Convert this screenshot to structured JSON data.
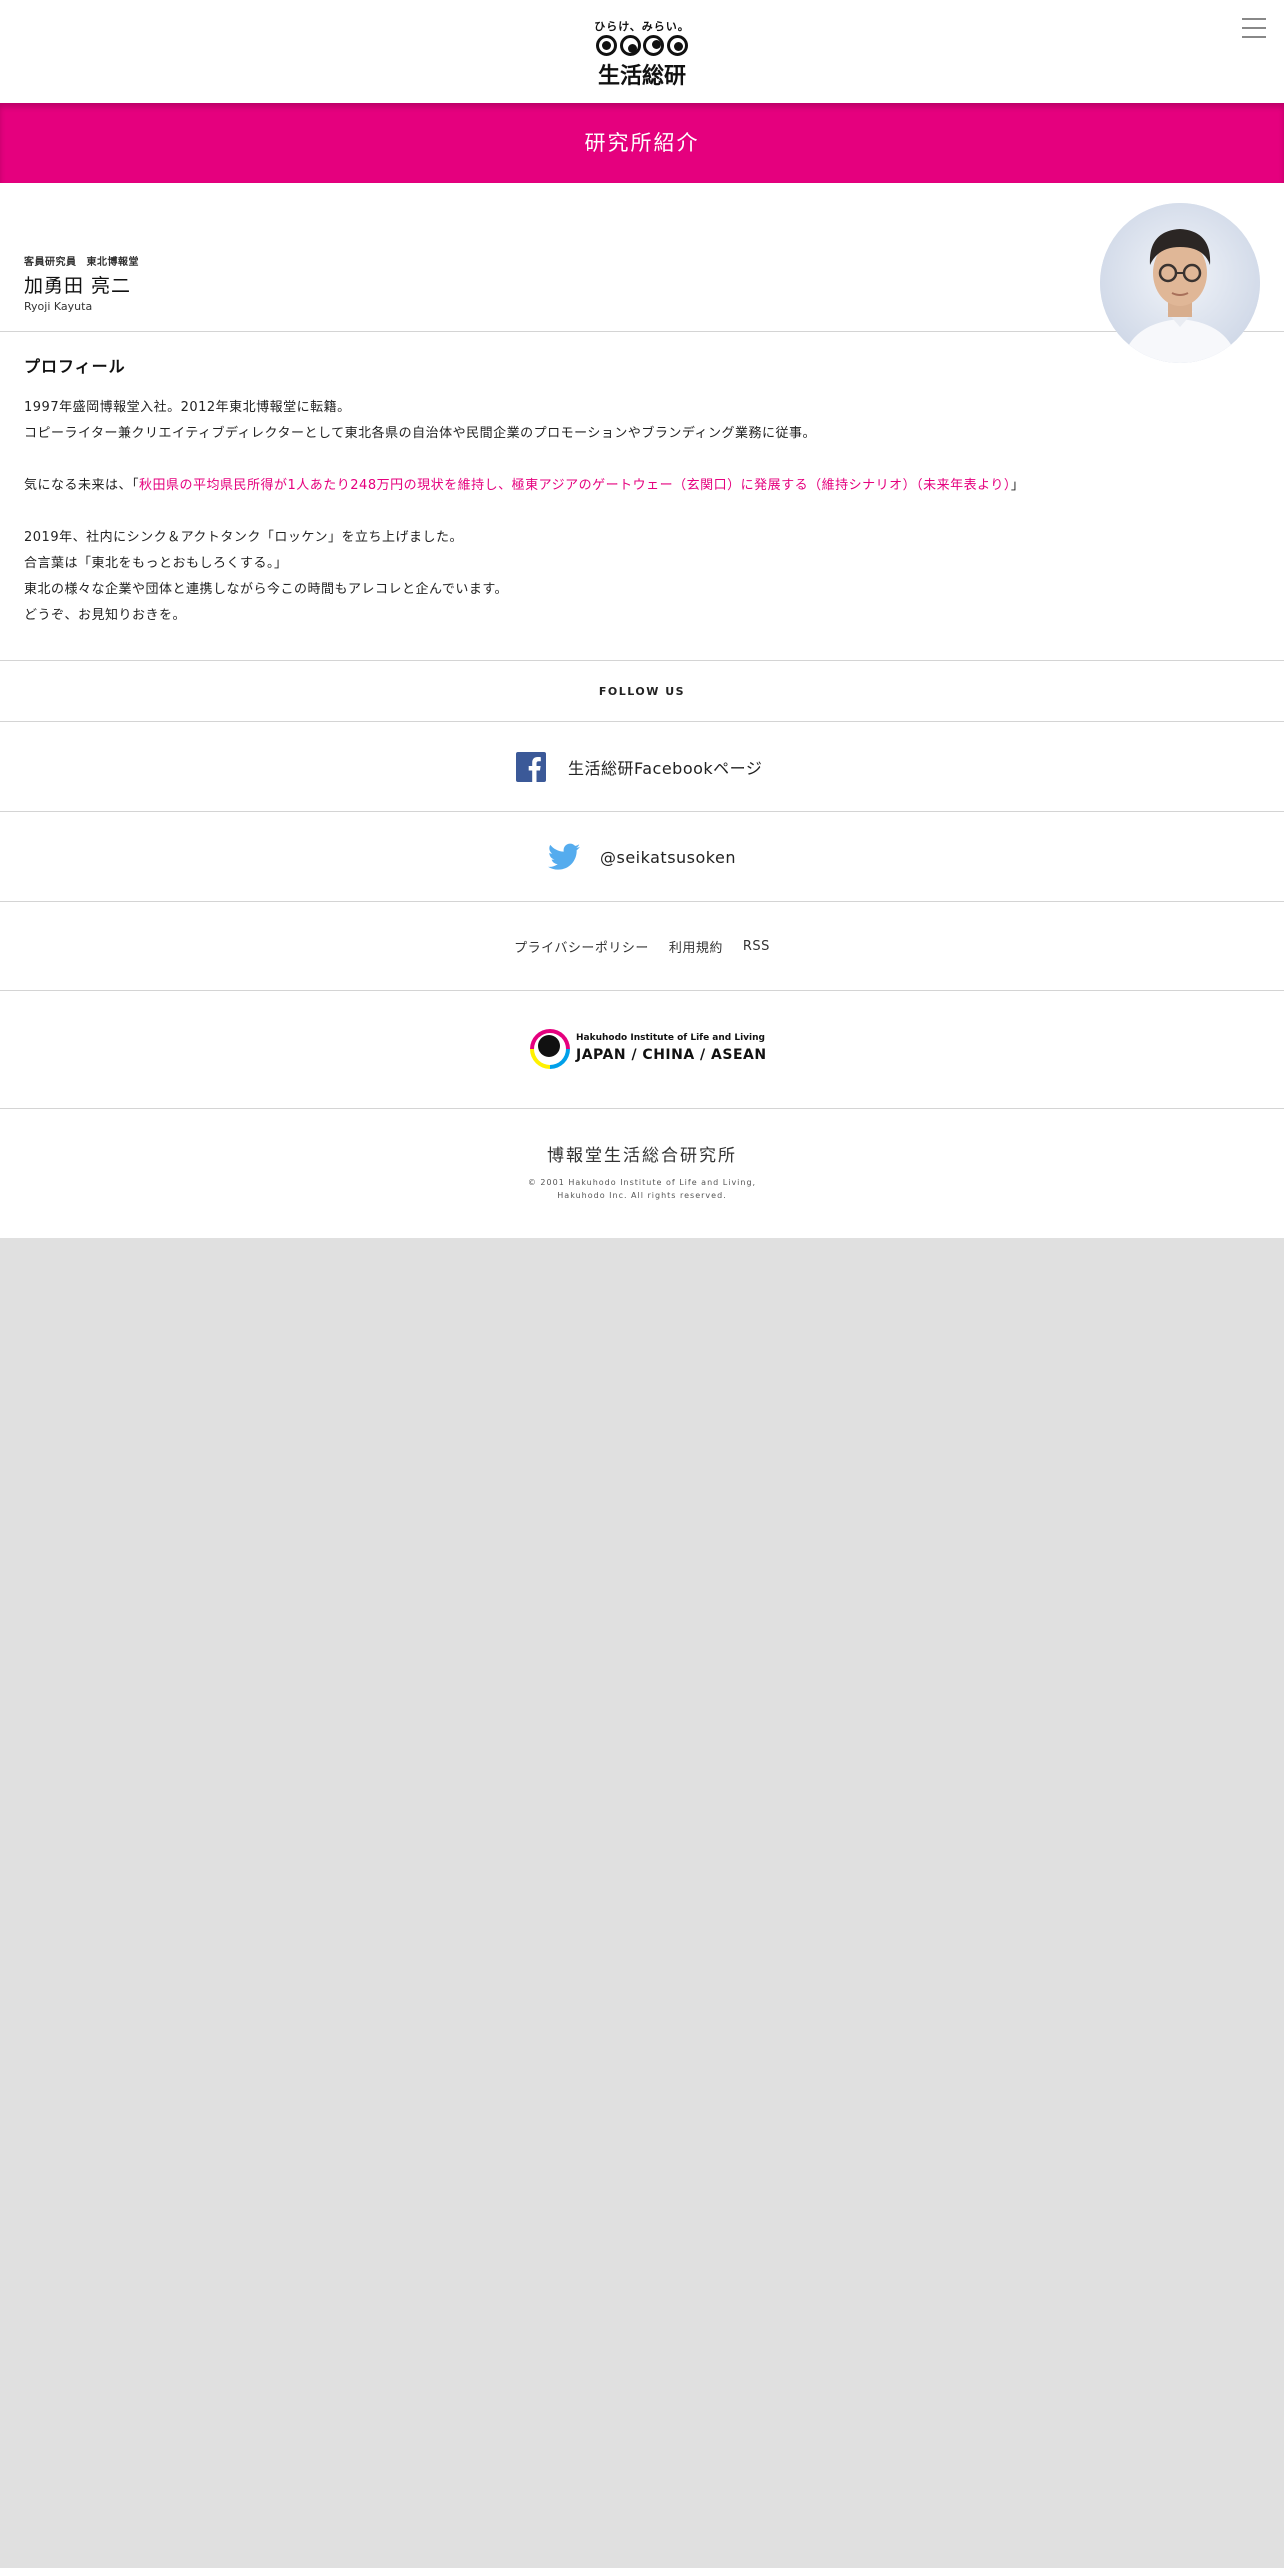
{
  "header": {
    "logo_tagline": "ひらけ、みらい。",
    "logo_name": "生活総研"
  },
  "title_bar": {
    "title": "研究所紹介"
  },
  "profile": {
    "role_primary": "客員研究員",
    "role_secondary": "東北博報堂",
    "name": "加勇田 亮二",
    "name_en": "Ryoji Kayuta",
    "section_title": "プロフィール",
    "line1": "1997年盛岡博報堂入社。2012年東北博報堂に転籍。",
    "line2": "コピーライター兼クリエイティブディレクターとして東北各県の自治体や民間企業のプロモーションやブランディング業務に従事。",
    "future_prefix": "気になる未来は、「",
    "future_highlight": "秋田県の平均県民所得が1人あたり248万円の現状を維持し、極東アジアのゲートウェー（玄関口）に発展する（維持シナリオ）（未来年表より）",
    "future_suffix": "」",
    "line4": "2019年、社内にシンク＆アクトタンク「ロッケン」を立ち上げました。",
    "line5": "合言葉は「東北をもっとおもしろくする。」",
    "line6": "東北の様々な企業や団体と連携しながら今この時間もアレコレと企んでいます。",
    "line7": "どうぞ、お見知りおきを。"
  },
  "footer": {
    "follow_label": "FOLLOW US",
    "facebook_label": "生活総研Facebookページ",
    "twitter_label": "@seikatsusoken",
    "links": [
      "プライバシーポリシー",
      "利用規約",
      "RSS"
    ],
    "brand_sub": "Hakuhodo Institute of Life and Living",
    "brand_main": "JAPAN / CHINA / ASEAN",
    "org_name": "博報堂生活総合研究所",
    "copyright_line1": "© 2001 Hakuhodo Institute of Life and Living,",
    "copyright_line2": "Hakuhodo Inc. All rights reserved."
  },
  "colors": {
    "accent": "#e5007e",
    "facebook": "#3b5998",
    "twitter": "#55acee",
    "background": "#e0e0e0"
  },
  "icons": [
    "menu-icon",
    "facebook-icon",
    "twitter-icon"
  ]
}
